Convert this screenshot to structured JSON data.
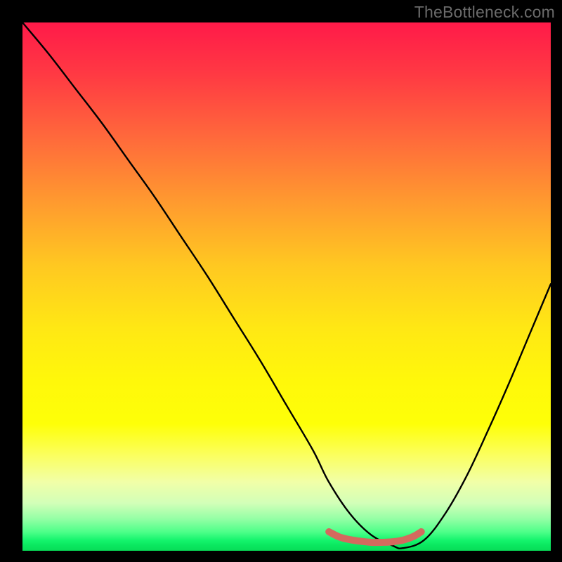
{
  "watermark": "TheBottleneck.com",
  "chart_data": {
    "type": "line",
    "title": "",
    "xlabel": "",
    "ylabel": "",
    "xlim": [
      0,
      100
    ],
    "ylim": [
      0,
      100
    ],
    "grid": false,
    "series": [
      {
        "name": "bottleneck-curve",
        "color": "#000000",
        "x": [
          0,
          5,
          10,
          15,
          20,
          25,
          30,
          35,
          40,
          45,
          50,
          55,
          58,
          62,
          66,
          70,
          72,
          76,
          80,
          84,
          88,
          92,
          96,
          100
        ],
        "values": [
          100,
          94,
          87.5,
          81,
          74,
          67,
          59.5,
          52,
          44,
          36,
          27.5,
          19,
          13,
          7,
          3,
          1,
          0.5,
          2,
          7,
          14,
          22.5,
          31.5,
          41,
          50.5
        ]
      },
      {
        "name": "optimal-zone-marker",
        "color": "#d36a5e",
        "x": [
          58,
          60,
          62,
          64,
          66,
          68,
          70,
          72,
          74,
          75.5
        ],
        "values": [
          3.6,
          2.6,
          2.1,
          1.8,
          1.6,
          1.6,
          1.7,
          2.0,
          2.7,
          3.6
        ]
      }
    ],
    "annotations": []
  }
}
